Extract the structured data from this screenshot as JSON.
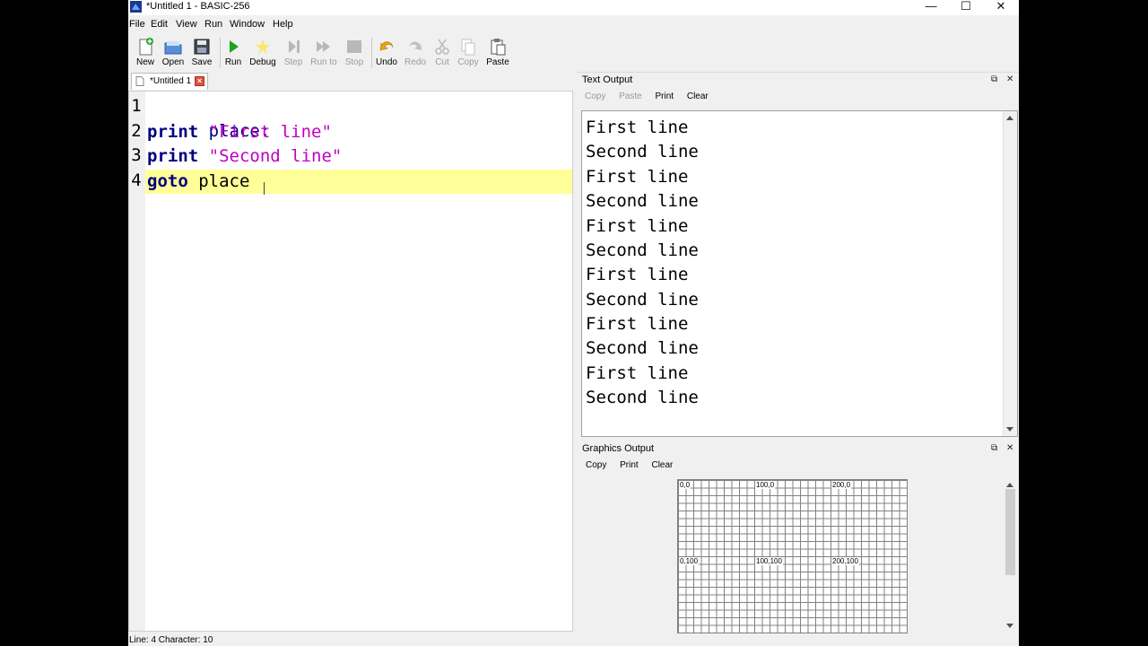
{
  "window": {
    "title": "*Untitled 1 - BASIC-256",
    "minimize": "—",
    "maximize": "☐",
    "close": "✕"
  },
  "menu": [
    "File",
    "Edit",
    "View",
    "Run",
    "Window",
    "Help"
  ],
  "toolbar": [
    {
      "label": "New",
      "icon": "new-file-icon",
      "enabled": true
    },
    {
      "label": "Open",
      "icon": "open-folder-icon",
      "enabled": true
    },
    {
      "label": "Save",
      "icon": "save-disk-icon",
      "enabled": true
    },
    {
      "label": "Run",
      "icon": "run-play-icon",
      "enabled": true
    },
    {
      "label": "Debug",
      "icon": "debug-bug-icon",
      "enabled": true
    },
    {
      "label": "Step",
      "icon": "step-icon",
      "enabled": false
    },
    {
      "label": "Run to",
      "icon": "run-to-icon",
      "enabled": false
    },
    {
      "label": "Stop",
      "icon": "stop-icon",
      "enabled": false
    },
    {
      "label": "Undo",
      "icon": "undo-icon",
      "enabled": true
    },
    {
      "label": "Redo",
      "icon": "redo-icon",
      "enabled": false
    },
    {
      "label": "Cut",
      "icon": "cut-scissors-icon",
      "enabled": false
    },
    {
      "label": "Copy",
      "icon": "copy-icon",
      "enabled": false
    },
    {
      "label": "Paste",
      "icon": "paste-clipboard-icon",
      "enabled": true
    }
  ],
  "editor": {
    "tab_label": "*Untitled 1",
    "line_numbers": [
      "1",
      "2",
      "3",
      "4"
    ],
    "lines": [
      {
        "parts": [
          {
            "t": "place:",
            "c": "lbl"
          }
        ]
      },
      {
        "parts": [
          {
            "t": "print",
            "c": "kw"
          },
          {
            "t": " ",
            "c": "plain"
          },
          {
            "t": "\"First line\"",
            "c": "str"
          }
        ]
      },
      {
        "parts": [
          {
            "t": "print",
            "c": "kw"
          },
          {
            "t": " ",
            "c": "plain"
          },
          {
            "t": "\"Second line\"",
            "c": "str"
          }
        ]
      },
      {
        "parts": [
          {
            "t": "goto",
            "c": "kw"
          },
          {
            "t": " place",
            "c": "plain"
          }
        ]
      }
    ]
  },
  "status_bar": "Line: 4 Character: 10",
  "text_output": {
    "title": "Text Output",
    "buttons": [
      {
        "label": "Copy",
        "enabled": false
      },
      {
        "label": "Paste",
        "enabled": false
      },
      {
        "label": "Print",
        "enabled": true
      },
      {
        "label": "Clear",
        "enabled": true
      }
    ],
    "lines": [
      "First line",
      "Second line",
      "First line",
      "Second line",
      "First line",
      "Second line",
      "First line",
      "Second line",
      "First line",
      "Second line",
      "First line",
      "Second line"
    ]
  },
  "graphics_output": {
    "title": "Graphics Output",
    "buttons": [
      {
        "label": "Copy",
        "enabled": true
      },
      {
        "label": "Print",
        "enabled": true
      },
      {
        "label": "Clear",
        "enabled": true
      }
    ],
    "grid_labels": [
      "0,0",
      "100,0",
      "200,0",
      "0,100",
      "100,100",
      "200,100"
    ]
  },
  "dock": {
    "float_icon": "⧉",
    "close_icon": "✕"
  }
}
